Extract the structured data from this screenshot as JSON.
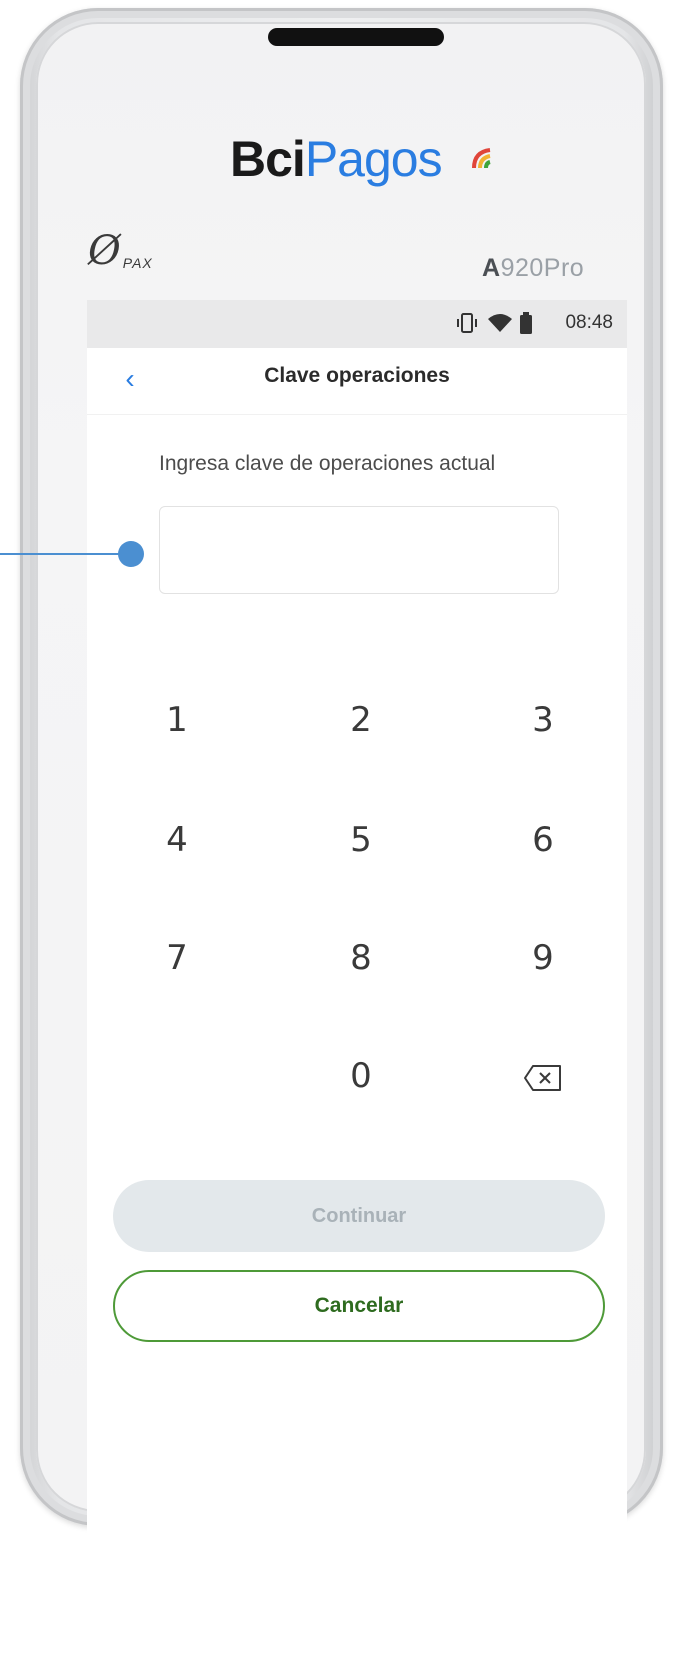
{
  "device": {
    "brand_bci": "Bci",
    "brand_pagos": "Pagos",
    "maker_logo": "PAX",
    "model_prefix": "A",
    "model_suffix": "920Pro"
  },
  "status_bar": {
    "time": "08:48",
    "icons": [
      "vibrate-icon",
      "wifi-icon",
      "battery-icon"
    ]
  },
  "header": {
    "back_icon": "chevron-left-icon",
    "back_glyph": "‹",
    "title": "Clave operaciones"
  },
  "form": {
    "instruction": "Ingresa clave de operaciones actual",
    "pin_value": ""
  },
  "keypad": {
    "keys": [
      "1",
      "2",
      "3",
      "4",
      "5",
      "6",
      "7",
      "8",
      "9",
      "0"
    ],
    "backspace_icon": "backspace-icon"
  },
  "actions": {
    "continue_label": "Continuar",
    "cancel_label": "Cancelar"
  },
  "colors": {
    "accent_blue": "#2a7de1",
    "cancel_green": "#4e9a38",
    "callout": "#4b8fd1",
    "disabled_bg": "#e3e8eb"
  }
}
